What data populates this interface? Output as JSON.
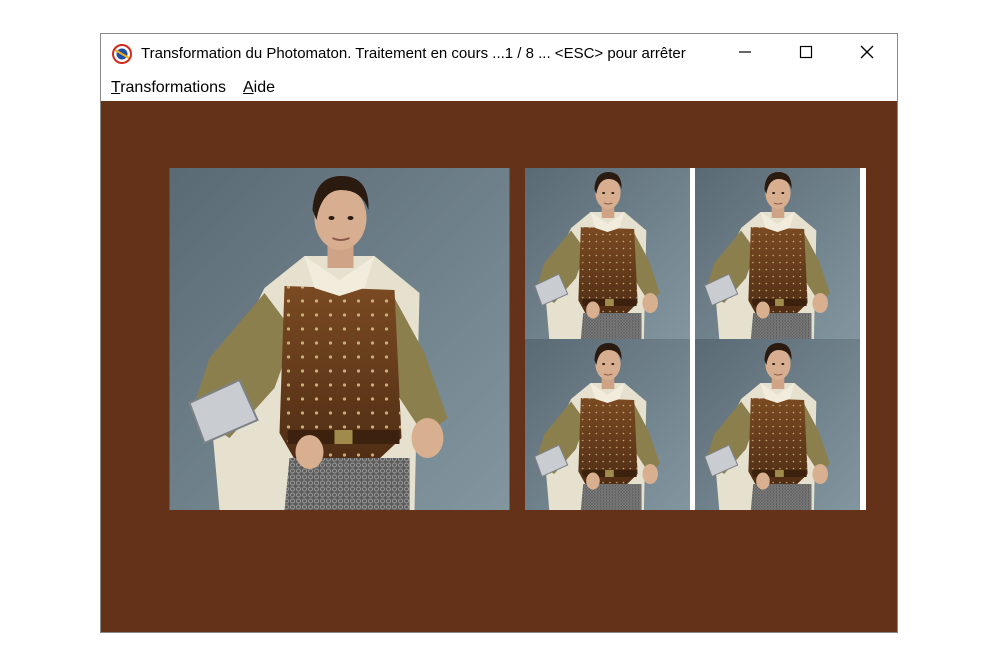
{
  "window": {
    "title": "Transformation du Photomaton. Traitement en cours ...1 / 8 ... <ESC> pour arrêter",
    "app_icon": "photomaton-app-icon",
    "controls": {
      "minimize": "minimize-icon",
      "maximize": "maximize-icon",
      "close": "close-icon"
    }
  },
  "menu": {
    "items": [
      {
        "first": "T",
        "rest": "ransformations"
      },
      {
        "first": "A",
        "rest": "ide"
      }
    ]
  },
  "canvas": {
    "background_color": "#633218",
    "original_photo": "portrait of man in leather armor with white cape",
    "tiles": [
      "portrait-copy-1",
      "portrait-copy-2",
      "portrait-copy-3",
      "portrait-copy-4"
    ]
  }
}
